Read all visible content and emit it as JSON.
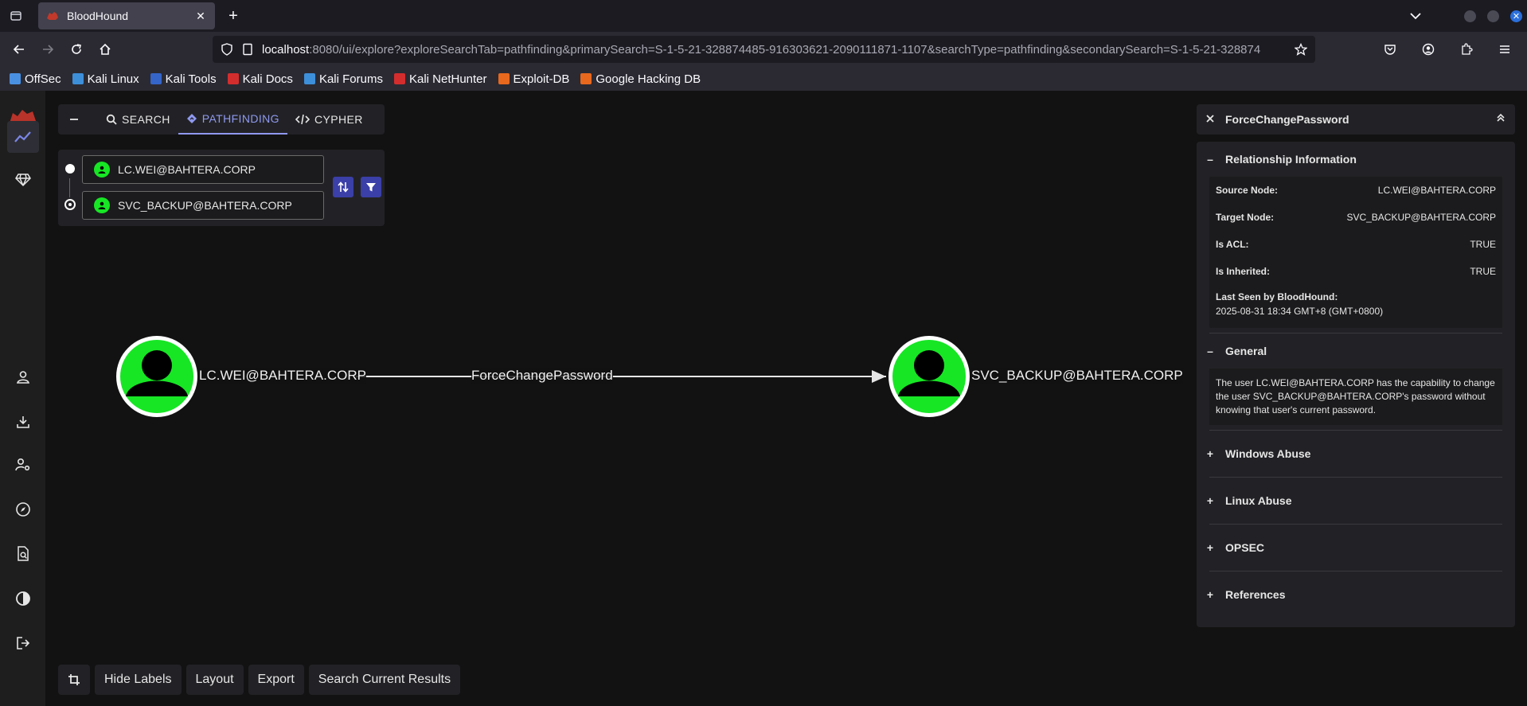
{
  "browser": {
    "tab_title": "BloodHound",
    "url_host": "localhost",
    "url_rest": ":8080/ui/explore?exploreSearchTab=pathfinding&primarySearch=S-1-5-21-328874485-916303621-2090111871-1107&searchType=pathfinding&secondarySearch=S-1-5-21-328874",
    "bookmarks": [
      {
        "label": "OffSec",
        "color": "#4a90e2"
      },
      {
        "label": "Kali Linux",
        "color": "#3d8fd9"
      },
      {
        "label": "Kali Tools",
        "color": "#3565c9"
      },
      {
        "label": "Kali Docs",
        "color": "#d42d2d"
      },
      {
        "label": "Kali Forums",
        "color": "#3d8fd9"
      },
      {
        "label": "Kali NetHunter",
        "color": "#d42d2d"
      },
      {
        "label": "Exploit-DB",
        "color": "#e8681e"
      },
      {
        "label": "Google Hacking DB",
        "color": "#e8681e"
      }
    ]
  },
  "explore": {
    "tabs": [
      {
        "label": "SEARCH",
        "icon": "search-icon"
      },
      {
        "label": "PATHFINDING",
        "icon": "diamond-icon"
      },
      {
        "label": "CYPHER",
        "icon": "code-icon"
      }
    ],
    "start_node": "LC.WEI@BAHTERA.CORP",
    "end_node": "SVC_BACKUP@BAHTERA.CORP"
  },
  "graph": {
    "source_label": "LC.WEI@BAHTERA.CORP",
    "target_label": "SVC_BACKUP@BAHTERA.CORP",
    "edge_label": "ForceChangePassword",
    "node_color": "#17e625"
  },
  "bottom_bar": {
    "hide_labels": "Hide Labels",
    "layout": "Layout",
    "export": "Export",
    "search_results": "Search Current Results"
  },
  "panel": {
    "title": "ForceChangePassword",
    "relationship": {
      "heading": "Relationship Information",
      "source_key": "Source Node:",
      "source_val": "LC.WEI@BAHTERA.CORP",
      "target_key": "Target Node:",
      "target_val": "SVC_BACKUP@BAHTERA.CORP",
      "acl_key": "Is ACL:",
      "acl_val": "TRUE",
      "inherited_key": "Is Inherited:",
      "inherited_val": "TRUE",
      "lastseen_key": "Last Seen by BloodHound:",
      "lastseen_val": "2025-08-31 18:34 GMT+8 (GMT+0800)"
    },
    "general": {
      "heading": "General",
      "text": "The user LC.WEI@BAHTERA.CORP has the capability to change the user SVC_BACKUP@BAHTERA.CORP's password without knowing that user's current password."
    },
    "windows_abuse": "Windows Abuse",
    "linux_abuse": "Linux Abuse",
    "opsec": "OPSEC",
    "references": "References"
  }
}
